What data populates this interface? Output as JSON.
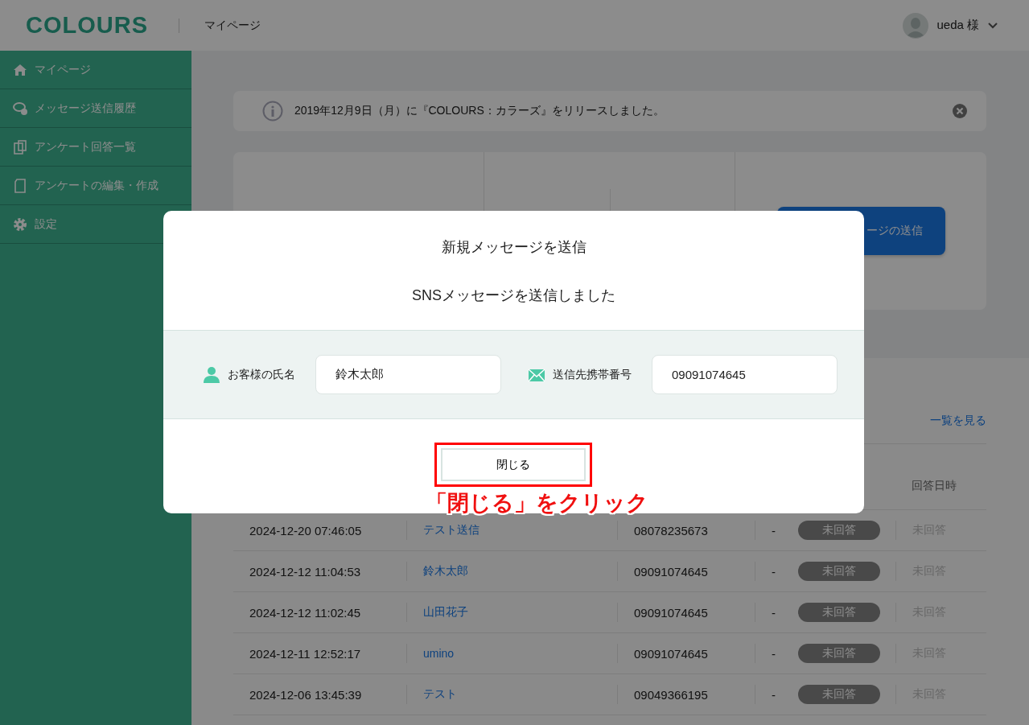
{
  "header": {
    "logo": "COLOURS",
    "page_title": "マイページ",
    "user": "ueda 様"
  },
  "sidebar": {
    "items": [
      {
        "label": "マイページ"
      },
      {
        "label": "メッセージ送信履歴"
      },
      {
        "label": "アンケート回答一覧"
      },
      {
        "label": "アンケートの編集・作成"
      },
      {
        "label": "設定"
      }
    ]
  },
  "notice": {
    "text": "2019年12月9日（月）に『COLOURS：カラーズ』をリリースしました。"
  },
  "send_button": "ージの送信",
  "list": {
    "more_link": "一覧を見る",
    "answered_header": "回答日時",
    "rows": [
      {
        "sent_at": "2024-12-20 07:46:05",
        "name": "テスト送信",
        "phone": "08078235673",
        "column_4": "-",
        "status": "未回答",
        "answered_at": "未回答"
      },
      {
        "sent_at": "2024-12-12 11:04:53",
        "name": "鈴木太郎",
        "phone": "09091074645",
        "column_4": "-",
        "status": "未回答",
        "answered_at": "未回答"
      },
      {
        "sent_at": "2024-12-12 11:02:45",
        "name": "山田花子",
        "phone": "09091074645",
        "column_4": "-",
        "status": "未回答",
        "answered_at": "未回答"
      },
      {
        "sent_at": "2024-12-11 12:52:17",
        "name": "umino",
        "phone": "09091074645",
        "column_4": "-",
        "status": "未回答",
        "answered_at": "未回答"
      },
      {
        "sent_at": "2024-12-06 13:45:39",
        "name": "テスト",
        "phone": "09049366195",
        "column_4": "-",
        "status": "未回答",
        "answered_at": "未回答"
      }
    ]
  },
  "modal": {
    "title": "新規メッセージを送信",
    "message": "SNSメッセージを送信しました",
    "fields": [
      {
        "label": "お客様の氏名",
        "value": "鈴木太郎"
      },
      {
        "label": "送信先携帯番号",
        "value": "09091074645"
      }
    ],
    "close_button": "閉じる"
  },
  "annotation": {
    "text": "「閉じる」をクリック"
  }
}
